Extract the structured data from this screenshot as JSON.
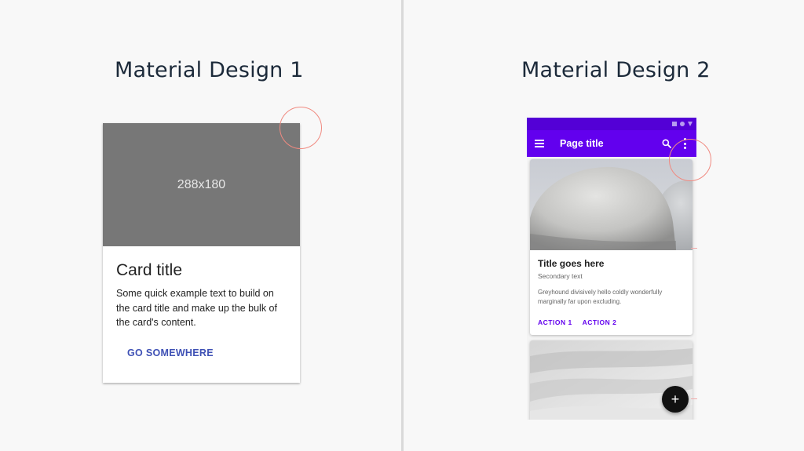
{
  "left_panel": {
    "heading": "Material Design 1",
    "card": {
      "image_label": "288x180",
      "title": "Card title",
      "text": "Some quick example text to build on the card title and make up the bulk of the card's content.",
      "button_label": "GO SOMEWHERE"
    }
  },
  "right_panel": {
    "heading": "Material Design 2",
    "app_bar": {
      "title": "Page title"
    },
    "card": {
      "title": "Title goes here",
      "secondary": "Secondary text",
      "body": "Greyhound divisively hello coldly wonderfully marginally far upon excluding.",
      "actions": [
        "ACTION 1",
        "ACTION 2"
      ]
    },
    "fab_label": "+"
  },
  "colors": {
    "md1_accent": "#3f51b5",
    "md2_primary": "#6200ee",
    "md2_status": "#5300d6",
    "highlight_circle": "#f08a80"
  }
}
